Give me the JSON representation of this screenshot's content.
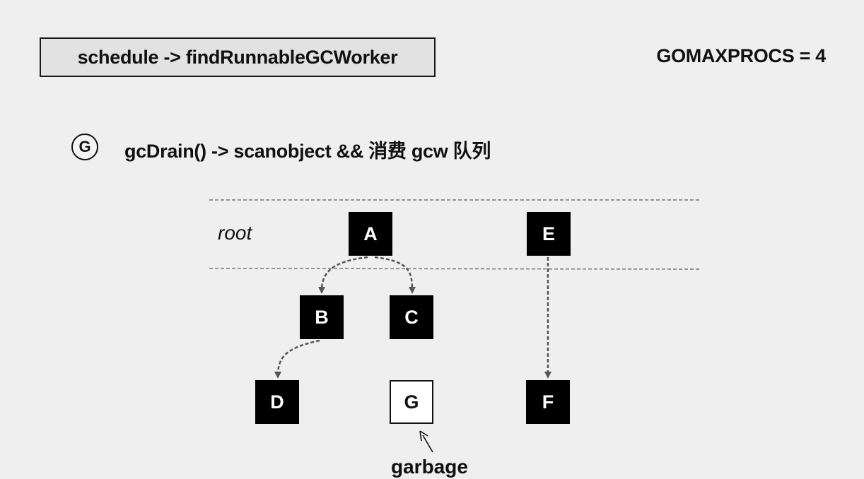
{
  "header": {
    "func_label": "schedule -> findRunnableGCWorker",
    "gomaxprocs": "GOMAXPROCS = 4"
  },
  "step": {
    "circle_letter": "G",
    "description": "gcDrain() -> scanobject && 消费 gcw 队列"
  },
  "diagram": {
    "root_label": "root",
    "nodes": {
      "A": "A",
      "B": "B",
      "C": "C",
      "D": "D",
      "E": "E",
      "F": "F",
      "G": "G"
    },
    "garbage_label": "garbage",
    "colors": {
      "reachable_node": "#000000",
      "garbage_node": "#ffffff",
      "edge": "#555555",
      "root_boundary": "#777777"
    }
  }
}
